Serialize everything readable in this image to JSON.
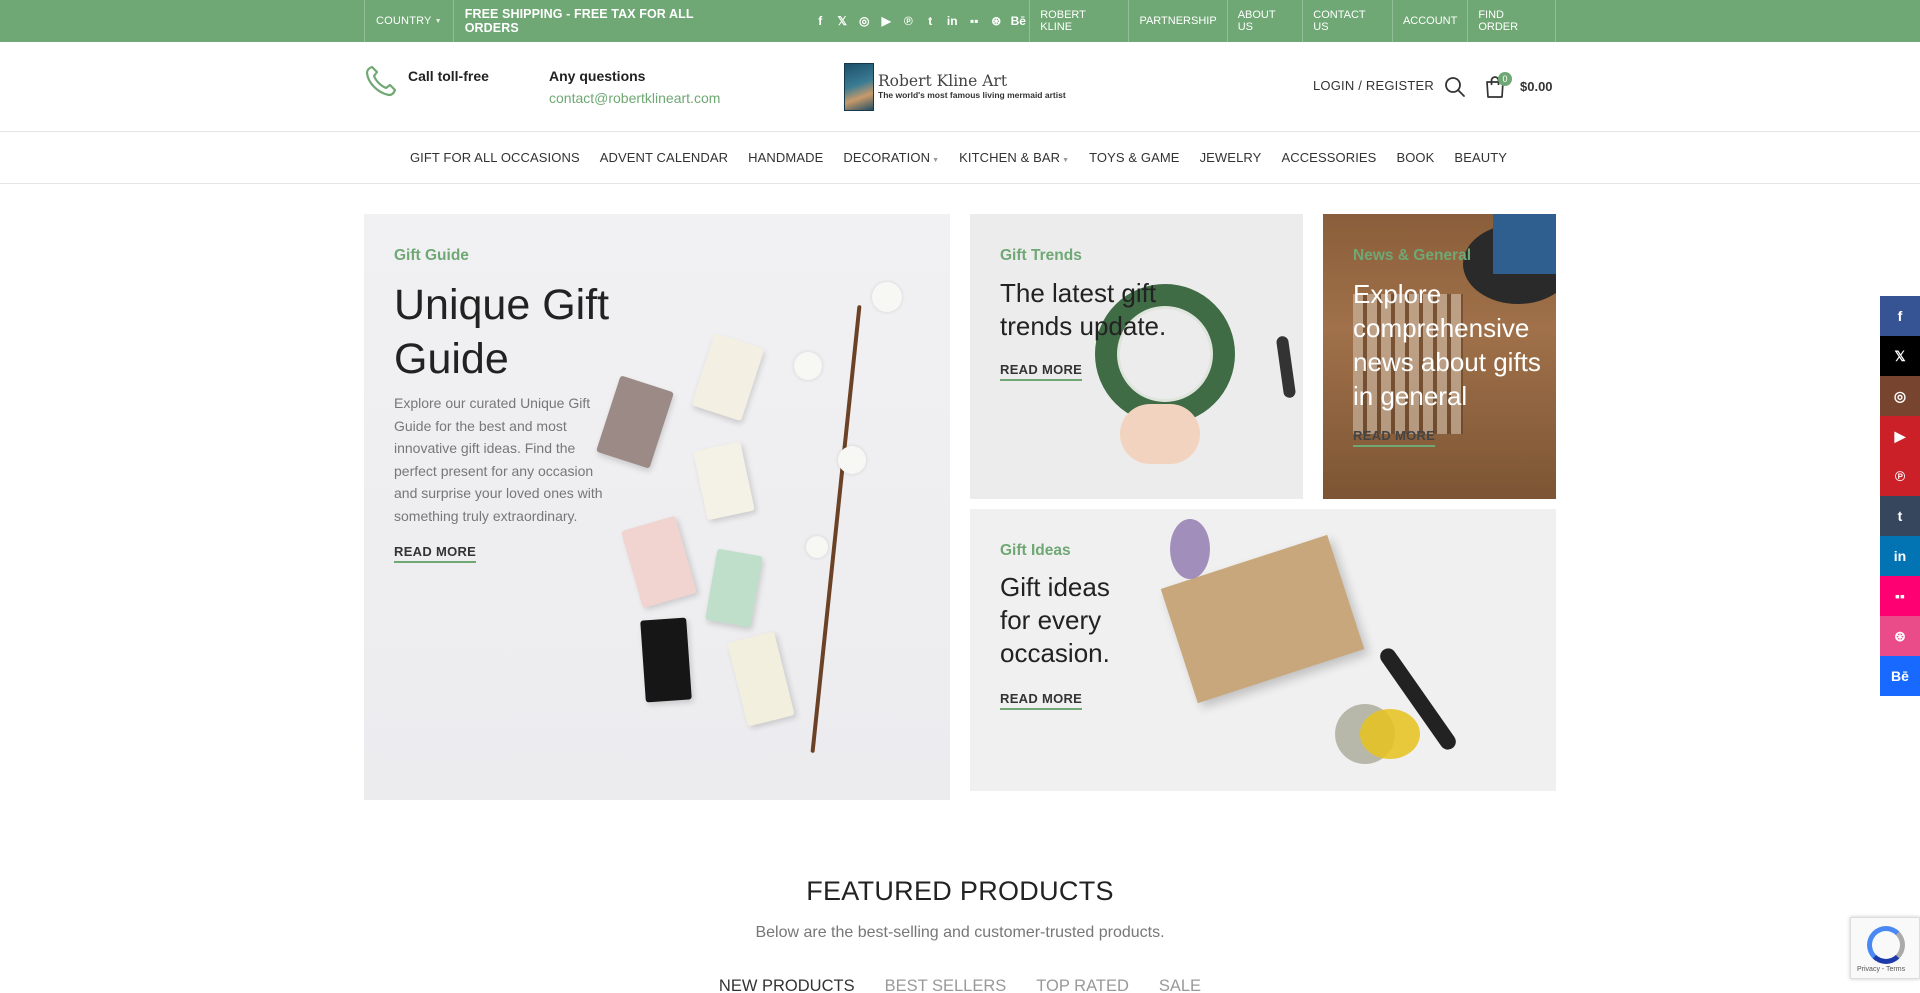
{
  "topbar": {
    "country_label": "COUNTRY",
    "shipping_text": "FREE SHIPPING - FREE TAX FOR ALL ORDERS",
    "social_icons": [
      "facebook-icon",
      "x-icon",
      "instagram-icon",
      "youtube-icon",
      "pinterest-icon",
      "tumblr-icon",
      "linkedin-icon",
      "flickr-icon",
      "dribbble-icon",
      "behance-icon"
    ],
    "social_glyphs": [
      "f",
      "𝕏",
      "◎",
      "▶",
      "℗",
      "t",
      "in",
      "▪▪",
      "⊛",
      "Bē"
    ],
    "links": [
      "ROBERT KLINE",
      "PARTNERSHIP",
      "ABOUT US",
      "CONTACT US",
      "ACCOUNT",
      "FIND ORDER"
    ],
    "background_color": "#6fa874"
  },
  "header": {
    "call_label": "Call toll-free",
    "questions_label": "Any questions",
    "email": "contact@robertklineart.com",
    "logo_name": "Robert Kline Art",
    "logo_tagline": "The world's most famous living mermaid artist",
    "login_label": "LOGIN / REGISTER",
    "cart_count": "0",
    "cart_total": "$0.00",
    "accent_color": "#6fa874"
  },
  "nav": {
    "items": [
      {
        "label": "GIFT FOR ALL OCCASIONS",
        "has_dropdown": false
      },
      {
        "label": "ADVENT CALENDAR",
        "has_dropdown": false
      },
      {
        "label": "HANDMADE",
        "has_dropdown": false
      },
      {
        "label": "DECORATION",
        "has_dropdown": true
      },
      {
        "label": "KITCHEN & BAR",
        "has_dropdown": true
      },
      {
        "label": "TOYS & GAME",
        "has_dropdown": false
      },
      {
        "label": "JEWELRY",
        "has_dropdown": false
      },
      {
        "label": "ACCESSORIES",
        "has_dropdown": false
      },
      {
        "label": "BOOK",
        "has_dropdown": false
      },
      {
        "label": "BEAUTY",
        "has_dropdown": false
      }
    ]
  },
  "banners": {
    "guide": {
      "category": "Gift Guide",
      "title": "Unique Gift Guide",
      "description": "Explore our curated Unique Gift Guide for the best and most innovative gift ideas. Find the perfect present for any occasion and surprise your loved ones with something truly extraordinary.",
      "cta": "READ MORE"
    },
    "trends": {
      "category": "Gift Trends",
      "title": "The latest gift trends update.",
      "cta": "READ MORE"
    },
    "news": {
      "category": "News & General",
      "title": "Explore comprehensive news about gifts in general",
      "cta": "READ MORE"
    },
    "ideas": {
      "category": "Gift Ideas",
      "title": "Gift ideas for every occasion.",
      "cta": "READ MORE"
    }
  },
  "featured": {
    "title": "FEATURED PRODUCTS",
    "subtitle": "Below are the best-selling and customer-trusted products.",
    "tabs": [
      "NEW PRODUCTS",
      "BEST SELLERS",
      "TOP RATED",
      "SALE"
    ],
    "active_tab": "NEW PRODUCTS"
  },
  "side_social": [
    {
      "icon": "facebook-icon",
      "glyph": "f",
      "color": "#365493"
    },
    {
      "icon": "x-icon",
      "glyph": "𝕏",
      "color": "#000000"
    },
    {
      "icon": "instagram-icon",
      "glyph": "◎",
      "color": "#774430"
    },
    {
      "icon": "youtube-icon",
      "glyph": "▶",
      "color": "#cb2027"
    },
    {
      "icon": "pinterest-icon",
      "glyph": "℗",
      "color": "#cb2027"
    },
    {
      "icon": "tumblr-icon",
      "glyph": "t",
      "color": "#36465d"
    },
    {
      "icon": "linkedin-icon",
      "glyph": "in",
      "color": "#0274b3"
    },
    {
      "icon": "flickr-icon",
      "glyph": "▪▪",
      "color": "#fe0072"
    },
    {
      "icon": "dribbble-icon",
      "glyph": "⊛",
      "color": "#ea4c89"
    },
    {
      "icon": "behance-icon",
      "glyph": "Bē",
      "color": "#1769ff"
    }
  ],
  "recaptcha": {
    "text": "Privacy - Terms"
  }
}
